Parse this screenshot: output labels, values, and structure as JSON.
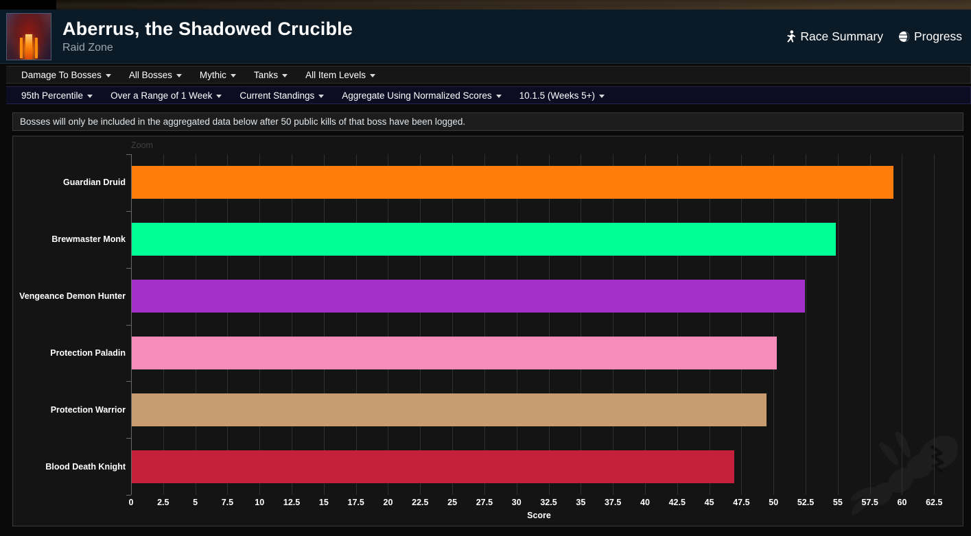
{
  "header": {
    "title": "Aberrus, the Shadowed Crucible",
    "subtitle": "Raid Zone",
    "thumb_icon": "raid-zone-thumbnail",
    "links": [
      {
        "label": "Race Summary",
        "icon": "running-person-icon"
      },
      {
        "label": "Progress",
        "icon": "globe-icon"
      }
    ]
  },
  "toolbar_primary": {
    "items": [
      {
        "label": "Damage To Bosses"
      },
      {
        "label": "All Bosses"
      },
      {
        "label": "Mythic"
      },
      {
        "label": "Tanks"
      },
      {
        "label": "All Item Levels"
      }
    ]
  },
  "toolbar_secondary": {
    "items": [
      {
        "label": "95th Percentile"
      },
      {
        "label": "Over a Range of 1 Week"
      },
      {
        "label": "Current Standings"
      },
      {
        "label": "Aggregate Using Normalized Scores"
      },
      {
        "label": "10.1.5 (Weeks 5+)"
      }
    ]
  },
  "notice": {
    "text": "Bosses will only be included in the aggregated data below after 50 public kills of that boss have been logged."
  },
  "chart_controls": {
    "zoom_label": "Zoom"
  },
  "chart_data": {
    "type": "bar",
    "orientation": "horizontal",
    "title": "",
    "xlabel": "Score",
    "ylabel": "",
    "xlim": [
      0,
      63.5
    ],
    "grid": true,
    "legend": "none",
    "categories": [
      "Guardian Druid",
      "Brewmaster Monk",
      "Vengeance Demon Hunter",
      "Protection Paladin",
      "Protection Warrior",
      "Blood Death Knight"
    ],
    "values": [
      59.3,
      54.8,
      52.4,
      50.2,
      49.4,
      46.9
    ],
    "colors": [
      "#FF7D0A",
      "#00FF96",
      "#A330C9",
      "#F58CBA",
      "#C79C6E",
      "#C41F3B"
    ],
    "xticks": [
      0,
      2.5,
      5,
      7.5,
      10,
      12.5,
      15,
      17.5,
      20,
      22.5,
      25,
      27.5,
      30,
      32.5,
      35,
      37.5,
      40,
      42.5,
      45,
      47.5,
      50,
      52.5,
      55,
      57.5,
      60,
      62.5
    ],
    "xtick_labels": [
      "0",
      "2.5",
      "5",
      "7.5",
      "10",
      "12.5",
      "15",
      "17.5",
      "20",
      "22.5",
      "25",
      "27.5",
      "30",
      "32.5",
      "35",
      "37.5",
      "40",
      "42.5",
      "45",
      "47.5",
      "50",
      "52.5",
      "55",
      "57.5",
      "60",
      "62.5"
    ]
  },
  "theme": {
    "header_bg": "#0a1a26",
    "panel_bg": "#141414",
    "accent_text": "#ffffff"
  }
}
